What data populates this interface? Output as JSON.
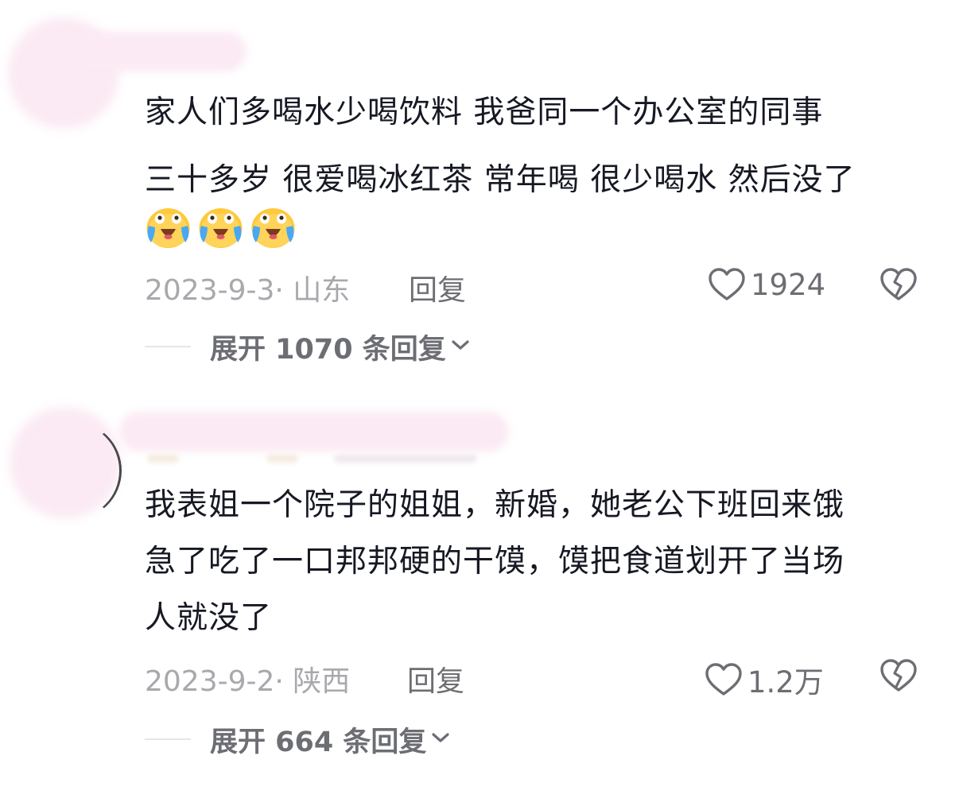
{
  "comments": [
    {
      "text_lines": [
        "家人们多喝水少喝饮料 我爸同一个办公室的同事",
        "三十多岁 很爱喝冰红茶 常年喝 很少喝水 然后没了"
      ],
      "emoji_icons": [
        "crying-laughing-emoji-icon",
        "crying-laughing-emoji-icon",
        "crying-laughing-emoji-icon"
      ],
      "date_location": "2023-9-3· 山东",
      "reply_label": "回复",
      "like_count": "1924",
      "expand_label": "展开 1070 条回复"
    },
    {
      "text_lines": [
        "我表姐一个院子的姐姐，新婚，她老公下班回来饿",
        "急了吃了一口邦邦硬的干馍，馍把食道划开了当场",
        "人就没了"
      ],
      "date_location": "2023-9-2· 陕西",
      "reply_label": "回复",
      "like_count": "1.2万",
      "expand_label": "展开 664 条回复"
    }
  ],
  "colors": {
    "text_primary": "#161823",
    "text_secondary": "#6d6e73",
    "text_muted": "#a8a8ad",
    "avatar_blur": "#fbeaf3",
    "emoji_face": "#ffc93c",
    "emoji_tears": "#4aa8f0"
  }
}
